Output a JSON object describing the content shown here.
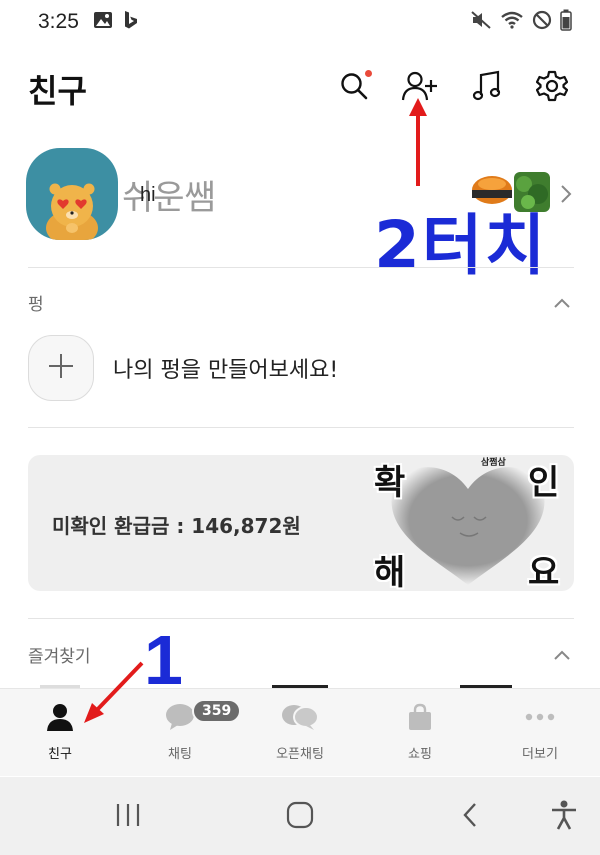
{
  "status_bar": {
    "time": "3:25",
    "left_icons": [
      "gallery-icon",
      "bing-icon"
    ],
    "right_icons": [
      "mute-icon",
      "wifi-icon",
      "dnd-icon",
      "battery-icon"
    ]
  },
  "header": {
    "title": "친구",
    "icons": [
      "search-icon",
      "add-friend-icon",
      "music-icon",
      "settings-icon"
    ],
    "search_has_notification": true
  },
  "profile": {
    "name": "쉬운쌤",
    "status_message": "hi"
  },
  "annotations": {
    "step2": "2터치",
    "step1": "1"
  },
  "pung_section": {
    "label": "펑",
    "create_text": "나의 펑을 만들어보세요!"
  },
  "refund_banner": {
    "text": "미확인 환급금 : 146,872원",
    "sticker_brand": "삼쩜삼",
    "sticker_chars": [
      "확",
      "인",
      "해",
      "요"
    ]
  },
  "favorites_section": {
    "label": "즐겨찾기"
  },
  "tabs": [
    {
      "label": "친구",
      "icon": "person-icon",
      "active": true
    },
    {
      "label": "채팅",
      "icon": "chat-bubble-icon",
      "badge": "359"
    },
    {
      "label": "오픈채팅",
      "icon": "open-chat-icon"
    },
    {
      "label": "쇼핑",
      "icon": "shopping-bag-icon"
    },
    {
      "label": "더보기",
      "icon": "more-dots-icon"
    }
  ],
  "colors": {
    "annotation_blue": "#1b2bd6",
    "annotation_red": "#e21b1b",
    "notification_dot": "#e94a3a"
  }
}
